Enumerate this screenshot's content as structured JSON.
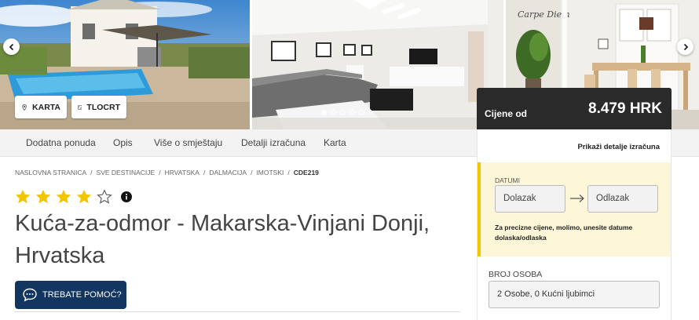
{
  "gallery": {
    "buttons": {
      "map": "KARTA",
      "floorplan": "TLOCRT"
    },
    "dots": [
      true,
      false,
      false,
      false,
      false
    ],
    "photo3_sign": "Carpe Diem"
  },
  "price": {
    "label": "Cijene od",
    "value": "8.479 HRK"
  },
  "tabs": [
    {
      "label": "Dodatna ponuda"
    },
    {
      "label": "Opis"
    },
    {
      "label": "Više o smještaju"
    },
    {
      "label": "Detalji izračuna"
    },
    {
      "label": "Karta"
    }
  ],
  "detail_link": "Prikaži detalje izračuna",
  "breadcrumb": [
    "NASLOVNA STRANICA",
    "SVE DESTINACIJE",
    "HRVATSKA",
    "DALMACIJA",
    "IMOTSKI",
    "CDE219"
  ],
  "rating": {
    "stars": 4,
    "max": 5
  },
  "title": "Kuća-za-odmor - Makarska-Vinjani Donji, Hrvatska",
  "help_button": "TREBATE POMOĆ?",
  "booking": {
    "dates_label": "DATUMI",
    "arrival_placeholder": "Dolazak",
    "departure_placeholder": "Odlazak",
    "dates_note": "Za precizne cijene, molimo, unesite datume dolaska/odlaska",
    "persons_label": "BROJ OSOBA",
    "persons_value": "2 Osobe, 0 Kućni ljubimci"
  },
  "colors": {
    "accent_yellow": "#f2c500",
    "help_navy": "#12365f",
    "price_bg": "#2a2a2a"
  }
}
